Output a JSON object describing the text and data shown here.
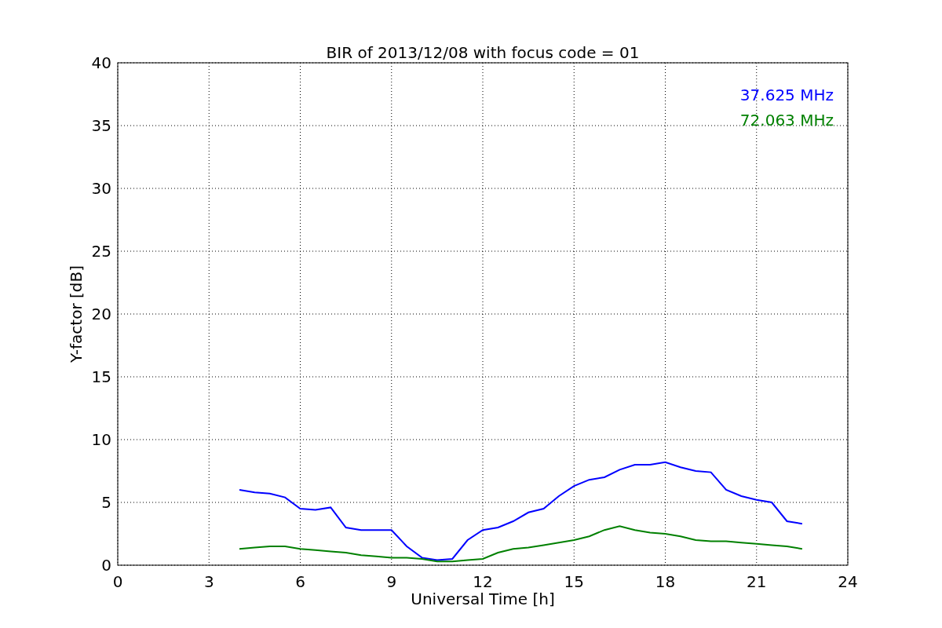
{
  "chart_data": {
    "type": "line",
    "title": "BIR of 2013/12/08 with focus code = 01",
    "xlabel": "Universal Time [h]",
    "ylabel": "Y-factor [dB]",
    "x": [
      4,
      4.5,
      5,
      5.5,
      6,
      6.5,
      7,
      7.5,
      8,
      8.5,
      9,
      9.5,
      10,
      10.5,
      11,
      11.5,
      12,
      12.5,
      13,
      13.5,
      14,
      14.5,
      15,
      15.5,
      16,
      16.5,
      17,
      17.5,
      18,
      18.5,
      19,
      19.5,
      20,
      20.5,
      21,
      21.5,
      22,
      22.5
    ],
    "series": [
      {
        "name": "37.625 MHz",
        "color": "#0000ff",
        "values": [
          6.0,
          5.8,
          5.7,
          5.4,
          4.5,
          4.4,
          4.6,
          3.0,
          2.8,
          2.8,
          2.8,
          1.5,
          0.6,
          0.4,
          0.5,
          2.0,
          2.8,
          3.0,
          3.5,
          4.2,
          4.5,
          5.5,
          6.3,
          6.8,
          7.0,
          7.6,
          8.0,
          8.0,
          8.2,
          7.8,
          7.5,
          7.4,
          6.0,
          5.5,
          5.2,
          5.0,
          3.5,
          3.3
        ]
      },
      {
        "name": "72.063 MHz",
        "color": "#008000",
        "values": [
          1.3,
          1.4,
          1.5,
          1.5,
          1.3,
          1.2,
          1.1,
          1.0,
          0.8,
          0.7,
          0.6,
          0.6,
          0.5,
          0.3,
          0.3,
          0.4,
          0.5,
          1.0,
          1.3,
          1.4,
          1.6,
          1.8,
          2.0,
          2.3,
          2.8,
          3.1,
          2.8,
          2.6,
          2.5,
          2.3,
          2.0,
          1.9,
          1.9,
          1.8,
          1.7,
          1.6,
          1.5,
          1.3
        ]
      }
    ],
    "grid": true,
    "xlim": [
      0,
      24
    ],
    "ylim": [
      0,
      40
    ],
    "xticks": [
      0,
      3,
      6,
      9,
      12,
      15,
      18,
      21,
      24
    ],
    "yticks": [
      0,
      5,
      10,
      15,
      20,
      25,
      30,
      35,
      40
    ]
  }
}
